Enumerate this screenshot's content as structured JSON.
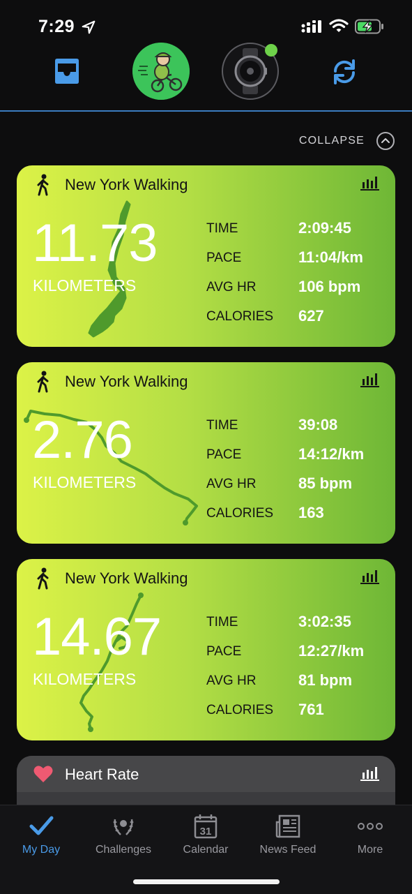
{
  "status_bar": {
    "time": "7:29"
  },
  "collapse": {
    "label": "COLLAPSE"
  },
  "activities": [
    {
      "title": "New York Walking",
      "distance": "11.73",
      "unit": "KILOMETERS",
      "stats": [
        {
          "label": "TIME",
          "value": "2:09:45"
        },
        {
          "label": "PACE",
          "value": "11:04/km"
        },
        {
          "label": "AVG HR",
          "value": "106 bpm"
        },
        {
          "label": "CALORIES",
          "value": "627"
        }
      ]
    },
    {
      "title": "New York Walking",
      "distance": "2.76",
      "unit": "KILOMETERS",
      "stats": [
        {
          "label": "TIME",
          "value": "39:08"
        },
        {
          "label": "PACE",
          "value": "14:12/km"
        },
        {
          "label": "AVG HR",
          "value": "85 bpm"
        },
        {
          "label": "CALORIES",
          "value": "163"
        }
      ]
    },
    {
      "title": "New York Walking",
      "distance": "14.67",
      "unit": "KILOMETERS",
      "stats": [
        {
          "label": "TIME",
          "value": "3:02:35"
        },
        {
          "label": "PACE",
          "value": "12:27/km"
        },
        {
          "label": "AVG HR",
          "value": "81 bpm"
        },
        {
          "label": "CALORIES",
          "value": "761"
        }
      ]
    }
  ],
  "heart_rate": {
    "title": "Heart Rate"
  },
  "tabs": [
    {
      "label": "My Day",
      "icon": "check-icon",
      "active": true
    },
    {
      "label": "Challenges",
      "icon": "laurel-icon",
      "active": false
    },
    {
      "label": "Calendar",
      "icon": "calendar-icon",
      "active": false,
      "badge": "31"
    },
    {
      "label": "News Feed",
      "icon": "newspaper-icon",
      "active": false
    },
    {
      "label": "More",
      "icon": "more-icon",
      "active": false
    }
  ],
  "colors": {
    "accent": "#4a9be8",
    "card_gradient_start": "#dcf247",
    "card_gradient_end": "#6eb736",
    "route": "#4f9a2c",
    "heart": "#ef5a72"
  }
}
